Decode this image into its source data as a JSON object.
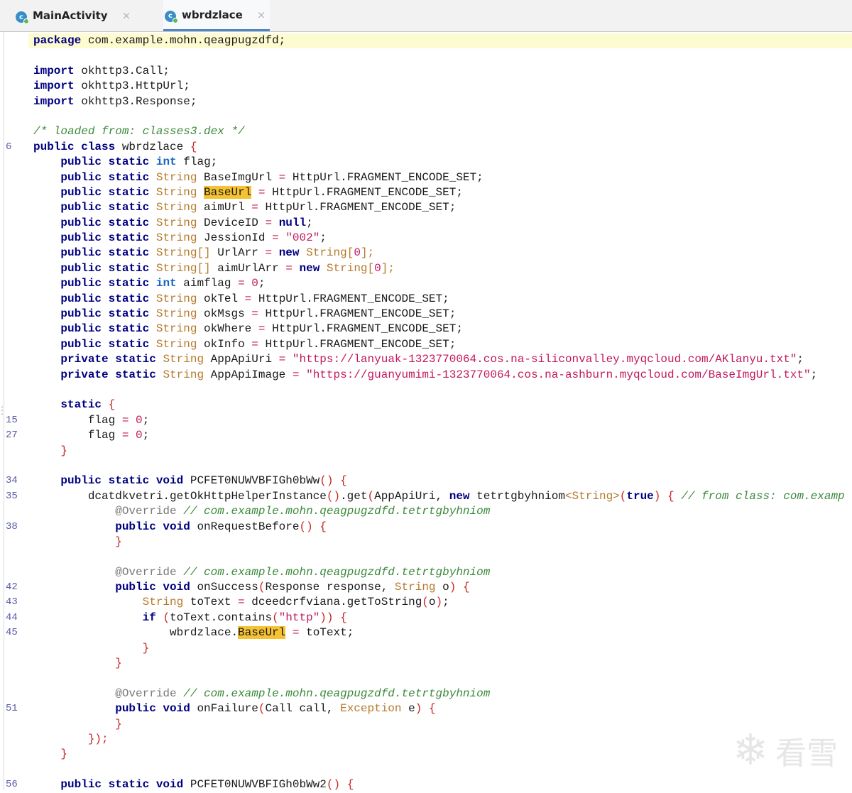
{
  "tabs": [
    {
      "label": "MainActivity",
      "close": "×"
    },
    {
      "label": "wbrdzlace",
      "close": "×"
    }
  ],
  "watermark": {
    "text": "看雪"
  },
  "code": {
    "l01": {
      "kw": "package",
      "rest": " com.example.mohn.qeagpugzdfd;"
    },
    "l03": {
      "kw": "import",
      "rest": " okhttp3.Call;"
    },
    "l04": {
      "kw": "import",
      "rest": " okhttp3.HttpUrl;"
    },
    "l05": {
      "kw": "import",
      "rest": " okhttp3.Response;"
    },
    "l07": {
      "comment": "/* loaded from: classes3.dex */"
    },
    "l08": {
      "ln": "6",
      "kw": "public class",
      "rest": " wbrdzlace ",
      "brace": "{"
    },
    "l09": {
      "kw": "public static",
      "type": "int",
      "rest": " flag;"
    },
    "l10": {
      "kw": "public static",
      "type": "String",
      "rest": " BaseImgUrl ",
      "eq": "=",
      "rest2": " HttpUrl.FRAGMENT_ENCODE_SET;"
    },
    "l11": {
      "kw": "public static",
      "type": "String",
      "mark": "BaseUrl",
      "eq": "=",
      "rest2": " HttpUrl.FRAGMENT_ENCODE_SET;"
    },
    "l12": {
      "kw": "public static",
      "type": "String",
      "rest": " aimUrl ",
      "eq": "=",
      "rest2": " HttpUrl.FRAGMENT_ENCODE_SET;"
    },
    "l13": {
      "kw": "public static",
      "type": "String",
      "rest": " DeviceID ",
      "eq": "=",
      "kw2": "null",
      "rest2": ";"
    },
    "l14": {
      "kw": "public static",
      "type": "String",
      "rest": " JessionId ",
      "eq": "=",
      "str": "\"002\"",
      "rest2": ";"
    },
    "l15": {
      "kw": "public static",
      "type": "String[]",
      "rest": " UrlArr ",
      "eq": "=",
      "kw2": "new",
      "type2": "String[",
      "num": "0",
      "rest2": "];"
    },
    "l16": {
      "kw": "public static",
      "type": "String[]",
      "rest": " aimUrlArr ",
      "eq": "=",
      "kw2": "new",
      "type2": "String[",
      "num": "0",
      "rest2": "];"
    },
    "l17": {
      "kw": "public static",
      "type": "int",
      "rest": " aimflag ",
      "eq": "=",
      "num": "0",
      "rest2": ";"
    },
    "l18": {
      "kw": "public static",
      "type": "String",
      "rest": " okTel ",
      "eq": "=",
      "rest2": " HttpUrl.FRAGMENT_ENCODE_SET;"
    },
    "l19": {
      "kw": "public static",
      "type": "String",
      "rest": " okMsgs ",
      "eq": "=",
      "rest2": " HttpUrl.FRAGMENT_ENCODE_SET;"
    },
    "l20": {
      "kw": "public static",
      "type": "String",
      "rest": " okWhere ",
      "eq": "=",
      "rest2": " HttpUrl.FRAGMENT_ENCODE_SET;"
    },
    "l21": {
      "kw": "public static",
      "type": "String",
      "rest": " okInfo ",
      "eq": "=",
      "rest2": " HttpUrl.FRAGMENT_ENCODE_SET;"
    },
    "l22": {
      "kw": "private static",
      "type": "String",
      "rest": " AppApiUri ",
      "eq": "=",
      "str": "\"https://lanyuak-1323770064.cos.na-siliconvalley.myqcloud.com/AKlanyu.txt\"",
      "rest2": ";"
    },
    "l23": {
      "kw": "private static",
      "type": "String",
      "rest": " AppApiImage ",
      "eq": "=",
      "str": "\"https://guanyumimi-1323770064.cos.na-ashburn.myqcloud.com/BaseImgUrl.txt\"",
      "rest2": ";"
    },
    "l25": {
      "kw": "static",
      "brace": "{"
    },
    "l26": {
      "ln": "15",
      "rest": "flag ",
      "eq": "=",
      "num": "0",
      "rest2": ";"
    },
    "l27": {
      "ln": "27",
      "rest": "flag ",
      "eq": "=",
      "num": "0",
      "rest2": ";"
    },
    "l28": {
      "brace": "}"
    },
    "l30": {
      "ln": "34",
      "kw": "public static void",
      "rest": " PCFET0NUWVBFIGh0bWw",
      "paren": "()",
      "brace": "{"
    },
    "l31": {
      "ln": "35",
      "rest": "dcatdkvetri.getOkHttpHelperInstance",
      "paren": "()",
      "rest2": ".get",
      "p2": "(",
      "rest3": "AppApiUri, ",
      "kw2": "new",
      "rest4": " tetrtgbyhniom",
      "type2": "<String>",
      "p3": "(",
      "kw3": "true",
      "p4": ")",
      "brace": "{",
      "comment": "// from class: com.examp"
    },
    "l32": {
      "ann": "@Override",
      "comment": "// com.example.mohn.qeagpugzdfd.tetrtgbyhniom"
    },
    "l33": {
      "ln": "38",
      "kw": "public void",
      "rest": " onRequestBefore",
      "paren": "()",
      "brace": "{"
    },
    "l34": {
      "brace": "}"
    },
    "l36": {
      "ann": "@Override",
      "comment": "// com.example.mohn.qeagpugzdfd.tetrtgbyhniom"
    },
    "l37": {
      "ln": "42",
      "kw": "public void",
      "rest": " onSuccess",
      "p1": "(",
      "rest2": "Response response, ",
      "type": "String",
      "rest3": " o",
      "p2": ")",
      "brace": "{"
    },
    "l38": {
      "ln": "43",
      "type": "String",
      "rest": " toText ",
      "eq": "=",
      "rest2": " dceedcrfviana.getToString",
      "p1": "(",
      "rest3": "o",
      "p2": ")",
      "rest4": ";"
    },
    "l39": {
      "ln": "44",
      "kw": "if",
      "p1": "(",
      "rest": "toText.contains",
      "p2": "(",
      "str": "\"http\"",
      "p3": "))",
      "brace": "{"
    },
    "l40": {
      "ln": "45",
      "rest": "wbrdzlace.",
      "mark": "BaseUrl",
      "eq": "=",
      "rest2": " toText;"
    },
    "l41": {
      "brace": "}"
    },
    "l42": {
      "brace": "}"
    },
    "l44": {
      "ann": "@Override",
      "comment": "// com.example.mohn.qeagpugzdfd.tetrtgbyhniom"
    },
    "l45": {
      "ln": "51",
      "kw": "public void",
      "rest": " onFailure",
      "p1": "(",
      "rest2": "Call call, ",
      "type": "Exception",
      "rest3": " e",
      "p2": ")",
      "brace": "{"
    },
    "l46": {
      "brace": "}"
    },
    "l47": {
      "brace": "});"
    },
    "l48": {
      "brace": "}"
    },
    "l50": {
      "ln": "56",
      "kw": "public static void",
      "rest": " PCFET0NUWVBFIGh0bWw2",
      "paren": "()",
      "brace": "{"
    }
  }
}
